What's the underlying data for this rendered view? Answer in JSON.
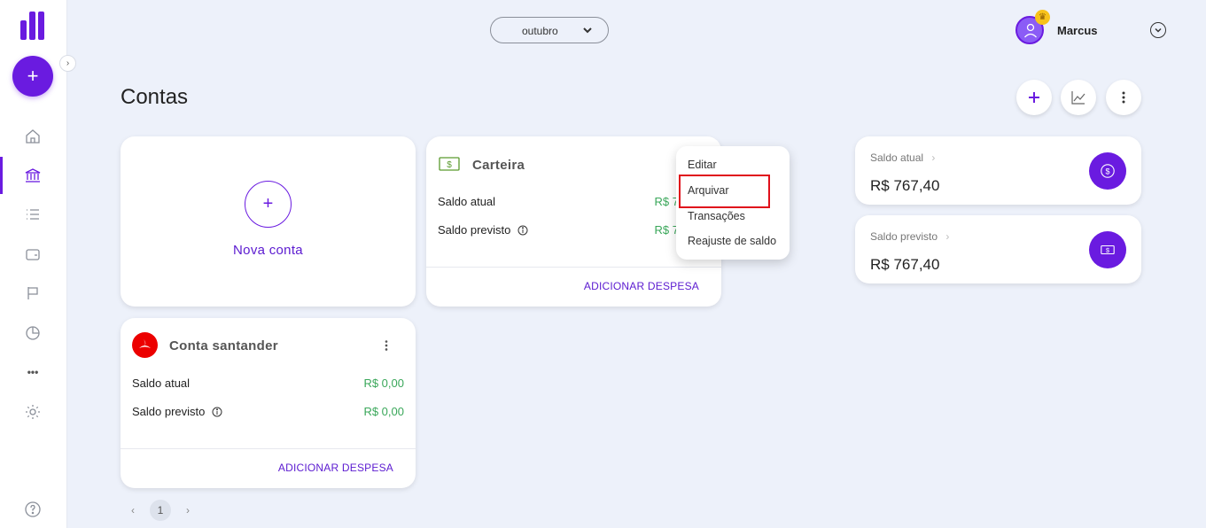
{
  "app": {
    "title": "Contas"
  },
  "colors": {
    "accent": "#6a1be0",
    "positive": "#3aa75a",
    "highlight": "#e0101b",
    "santander": "#ec0000"
  },
  "sidebar": {
    "fab_icon": "plus-icon",
    "collapse_icon": "chevron-right-icon",
    "items": [
      {
        "name": "home",
        "icon": "home-icon"
      },
      {
        "name": "accounts",
        "icon": "bank-icon",
        "active": true
      },
      {
        "name": "transactions",
        "icon": "list-icon"
      },
      {
        "name": "cards",
        "icon": "wallet-icon"
      },
      {
        "name": "goals",
        "icon": "flag-icon"
      },
      {
        "name": "reports",
        "icon": "pie-chart-icon"
      },
      {
        "name": "more",
        "icon": "more-icon"
      },
      {
        "name": "settings",
        "icon": "gear-icon"
      },
      {
        "name": "help",
        "icon": "help-icon"
      }
    ],
    "more_label": "•••",
    "help_label": "?"
  },
  "header": {
    "month": "outubro",
    "user_name": "Marcus"
  },
  "page": {
    "title": "Contas",
    "actions": [
      "add-icon",
      "chart-line-icon",
      "more-vertical-icon"
    ]
  },
  "new_account": {
    "label": "Nova conta",
    "icon": "+"
  },
  "accounts": [
    {
      "name": "Carteira",
      "icon": "cash-icon",
      "saldo_atual_label": "Saldo atual",
      "saldo_atual_value": "R$ 7",
      "saldo_previsto_label": "Saldo previsto",
      "saldo_previsto_value": "R$ 7",
      "action": "ADICIONAR DESPESA"
    },
    {
      "name": "Conta santander",
      "icon": "santander-icon",
      "saldo_atual_label": "Saldo atual",
      "saldo_atual_value": "R$ 0,00",
      "saldo_previsto_label": "Saldo previsto",
      "saldo_previsto_value": "R$ 0,00",
      "action": "ADICIONAR DESPESA"
    }
  ],
  "context_menu": {
    "items": [
      "Editar",
      "Arquivar",
      "Transações",
      "Reajuste de saldo"
    ],
    "highlighted": "Arquivar"
  },
  "summary": {
    "saldo_atual": {
      "label": "Saldo atual",
      "value": "R$ 767,40",
      "chevron": "›"
    },
    "saldo_previsto": {
      "label": "Saldo previsto",
      "value": "R$ 767,40",
      "chevron": "›"
    }
  },
  "pagination": {
    "prev": "‹",
    "current": "1",
    "next": "›"
  }
}
